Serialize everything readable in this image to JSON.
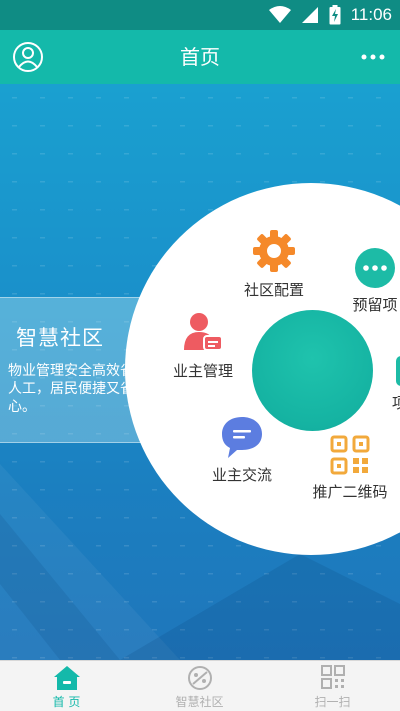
{
  "status_bar": {
    "time": "11:06",
    "icons": [
      "wifi-icon",
      "signal-icon",
      "battery-charging-icon"
    ]
  },
  "header": {
    "title": "首页",
    "left_icon": "user-profile-icon",
    "right_icon": "more-dots-icon"
  },
  "intro": {
    "title": "智慧社区",
    "description": "物业管理安全高效省人工，居民便捷又省心。"
  },
  "menu": [
    {
      "label": "社区配置",
      "icon": "gear-icon",
      "color": "#f5892a"
    },
    {
      "label": "预留项",
      "icon": "more-chat-icon",
      "color": "#1dbba6"
    },
    {
      "label": "业主管理",
      "icon": "owner-manage-icon",
      "color": "#ee5b61"
    },
    {
      "label": "业主交流",
      "icon": "chat-bubble-icon",
      "color": "#5c7de0"
    },
    {
      "label": "推广二维码",
      "icon": "qr-code-icon",
      "color": "#f2a93b"
    },
    {
      "label": "项",
      "icon": "partial-item-icon",
      "color": "#1dbba6"
    }
  ],
  "bottom_nav": [
    {
      "label": "首 页",
      "icon": "home-icon",
      "active": true
    },
    {
      "label": "智慧社区",
      "icon": "smart-community-icon",
      "active": false
    },
    {
      "label": "扫一扫",
      "icon": "scan-icon",
      "active": false
    }
  ],
  "colors": {
    "primary": "#14b9aa",
    "active_tab": "#14b9aa",
    "inactive_tab": "#b0b0b0"
  }
}
